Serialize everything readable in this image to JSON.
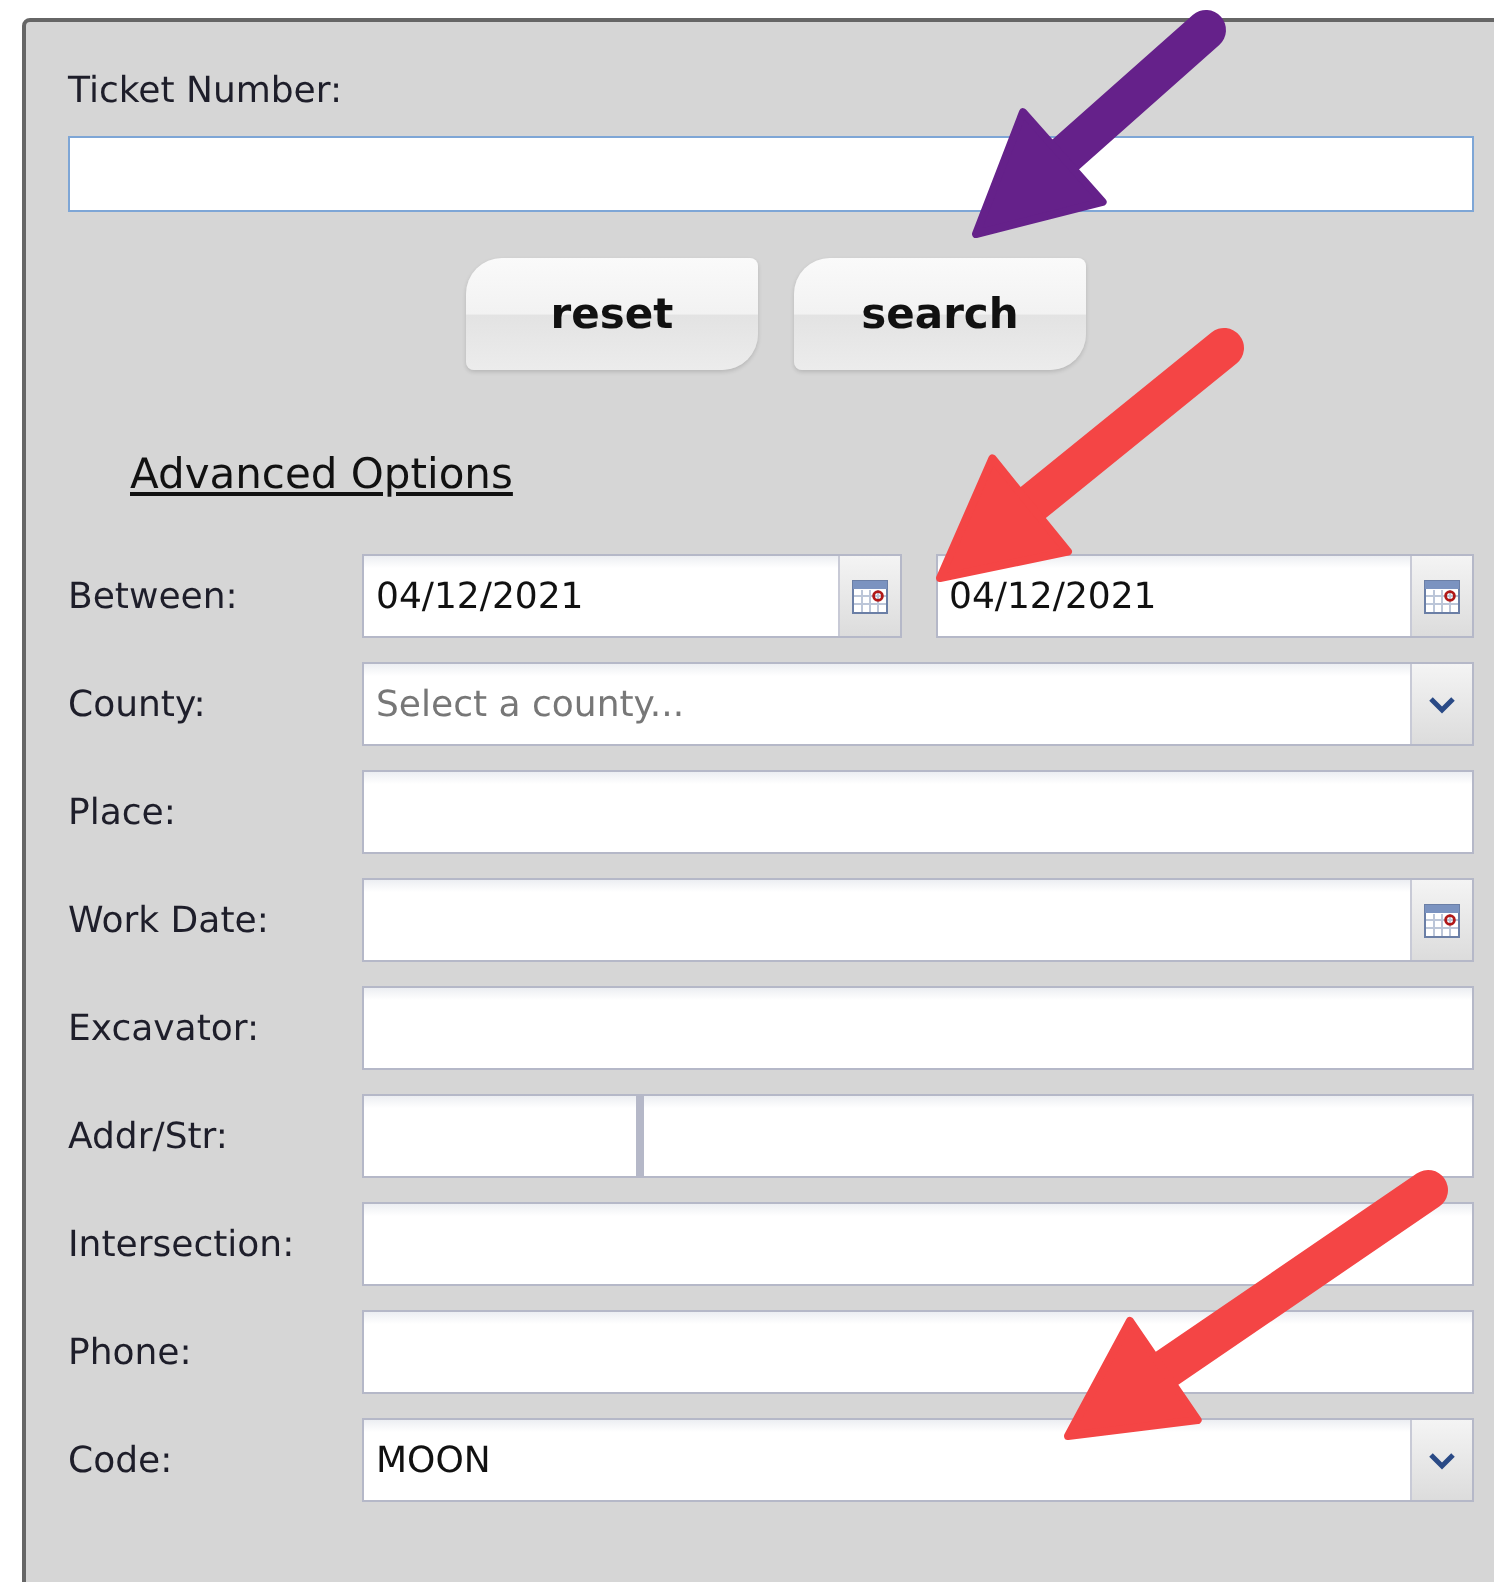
{
  "ticket": {
    "label": "Ticket Number:",
    "focused": true
  },
  "buttons": [
    "reset",
    "search"
  ],
  "advanced_link": "Advanced Options",
  "rows": [
    {
      "kind": "date_range",
      "label": "Between:",
      "values": [
        "04/12/2021",
        "04/12/2021"
      ]
    },
    {
      "kind": "select",
      "label": "County:",
      "placeholder": "Select a county..."
    },
    {
      "kind": "text",
      "label": "Place:"
    },
    {
      "kind": "date",
      "label": "Work Date:"
    },
    {
      "kind": "text",
      "label": "Excavator:"
    },
    {
      "kind": "split_text",
      "label": "Addr/Str:"
    },
    {
      "kind": "text",
      "label": "Intersection:"
    },
    {
      "kind": "text",
      "label": "Phone:"
    },
    {
      "kind": "select",
      "label": "Code:",
      "value": "MOON"
    }
  ],
  "annotation_arrows": [
    {
      "color": "#65218a"
    },
    {
      "color": "#f44545"
    },
    {
      "color": "#f44545"
    }
  ]
}
